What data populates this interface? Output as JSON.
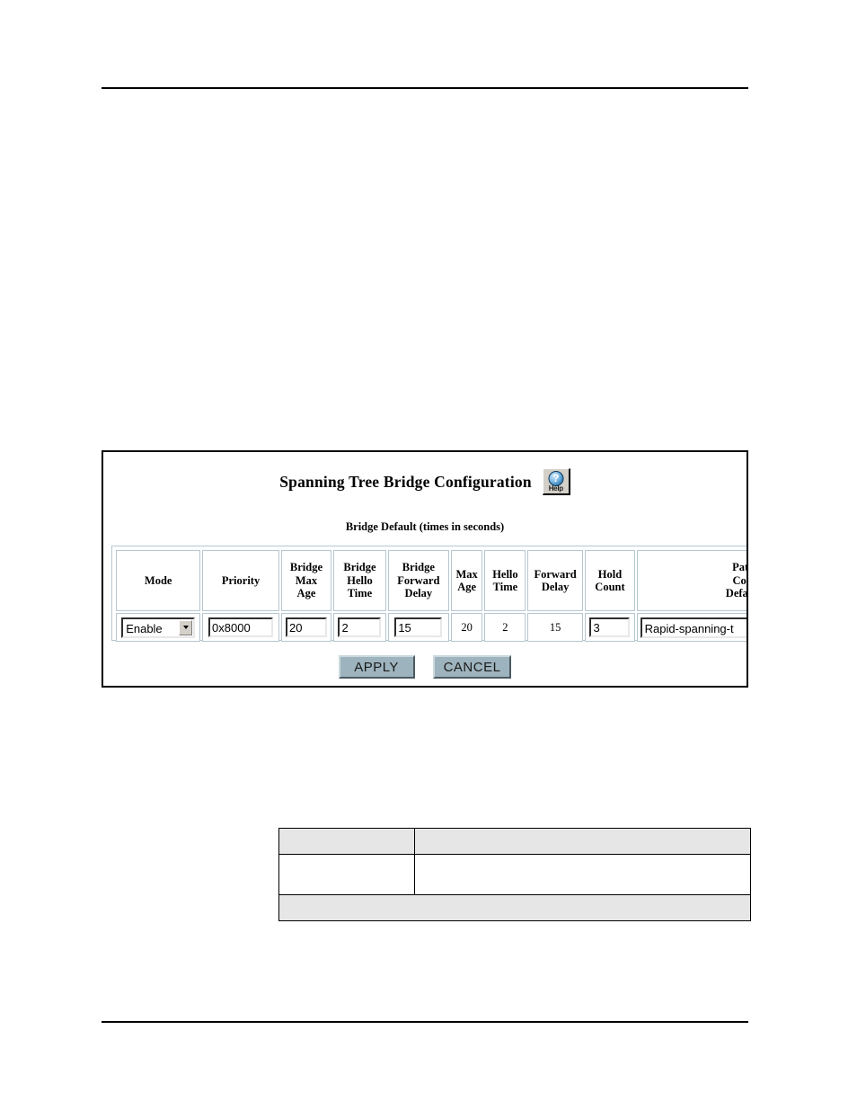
{
  "page": {
    "rules": {
      "top_label": "header-rule",
      "bottom_label": "footer-rule"
    }
  },
  "panel": {
    "title": "Spanning Tree Bridge Configuration",
    "subtitle": "Bridge Default (times in seconds)",
    "help_button": {
      "badge": "?",
      "label": "Help",
      "icon": "help-question-icon"
    }
  },
  "bridge_table": {
    "headers": [
      "Mode",
      "Priority",
      "Bridge Max Age",
      "Bridge Hello Time",
      "Bridge Forward Delay",
      "Max Age",
      "Hello Time",
      "Forward Delay",
      "Hold Count",
      "Path Cost Default"
    ],
    "headers_lines": {
      "mode": "Mode",
      "priority": "Priority",
      "bridge_max_age": [
        "Bridge",
        "Max",
        "Age"
      ],
      "bridge_hello_time": [
        "Bridge",
        "Hello",
        "Time"
      ],
      "bridge_forward_delay": [
        "Bridge",
        "Forward",
        "Delay"
      ],
      "max_age": [
        "Max",
        "Age"
      ],
      "hello_time": [
        "Hello",
        "Time"
      ],
      "forward_delay": [
        "Forward",
        "Delay"
      ],
      "hold_count": [
        "Hold",
        "Count"
      ],
      "path_cost_default": [
        "Path",
        "Cost",
        "Default"
      ]
    },
    "row": {
      "mode": "Enable",
      "priority": "0x8000",
      "bridge_max_age": "20",
      "bridge_hello_time": "2",
      "bridge_forward_delay": "15",
      "max_age": "20",
      "hello_time": "2",
      "forward_delay": "15",
      "hold_count": "3",
      "path_cost_default": "Rapid-spanning-t"
    }
  },
  "actions": {
    "apply_label": "APPLY",
    "cancel_label": "CANCEL"
  },
  "lower_table": {
    "rows": [
      {
        "cells": [
          "",
          ""
        ]
      },
      {
        "cells": [
          "",
          ""
        ]
      },
      {
        "cells": [
          ""
        ]
      }
    ]
  },
  "colors": {
    "button_face": "#9db3bd",
    "help_badge_blue": "#2e7cb8",
    "table_border": "#b6c7d0",
    "shaded_row": "#e6e6e6",
    "text": "#000000"
  }
}
